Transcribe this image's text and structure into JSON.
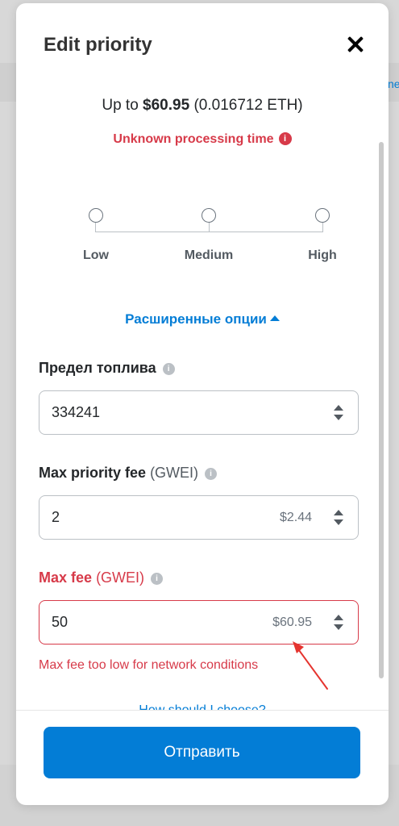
{
  "background": {
    "partial_link": "ne"
  },
  "modal": {
    "title": "Edit priority",
    "close_icon": "close-icon"
  },
  "summary": {
    "prefix": "Up to ",
    "fiat": "$60.95",
    "eth": " (0.016712 ETH)"
  },
  "warning": {
    "text": "Unknown processing time",
    "icon": "info-icon",
    "icon_glyph": "i"
  },
  "slider": {
    "levels": [
      "Low",
      "Medium",
      "High"
    ],
    "selected": null
  },
  "advanced": {
    "label": "Расширенные опции"
  },
  "fields": {
    "gas_limit": {
      "label": "Предел топлива",
      "value": "334241"
    },
    "max_priority_fee": {
      "label": "Max priority fee",
      "unit": "(GWEI)",
      "value": "2",
      "fiat": "$2.44"
    },
    "max_fee": {
      "label": "Max fee",
      "unit": "(GWEI)",
      "value": "50",
      "fiat": "$60.95",
      "error": "Max fee too low for network conditions"
    }
  },
  "help_link": {
    "label": "How should I choose?"
  },
  "submit": {
    "label": "Отправить"
  },
  "colors": {
    "accent": "#037dd6",
    "error": "#d73a49",
    "annotation_arrow": "#e5342f"
  }
}
